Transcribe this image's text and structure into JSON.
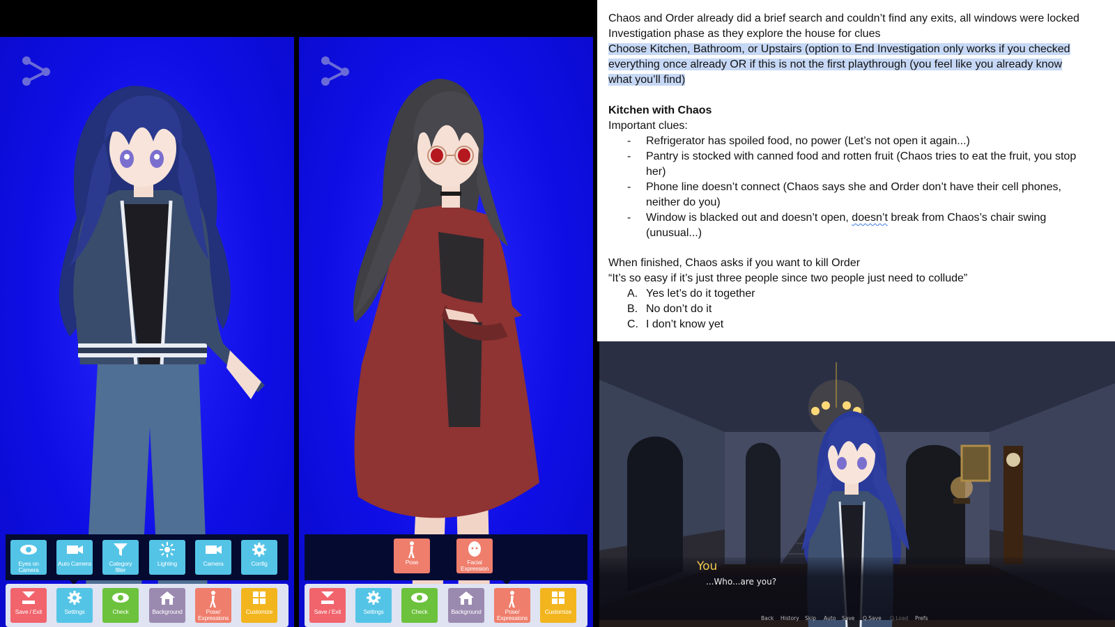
{
  "toolbar_rows": {
    "left_dark": [
      {
        "id": "eyes-on-camera",
        "label": "Eyes on\nCamera",
        "icon": "eye-icon",
        "color": "#54c4e6"
      },
      {
        "id": "auto-camera",
        "label": "Auto Camera",
        "icon": "video-camera-icon",
        "color": "#54c4e6"
      },
      {
        "id": "category-filter",
        "label": "Category\nfilter",
        "icon": "filter-icon",
        "color": "#54c4e6"
      },
      {
        "id": "lighting",
        "label": "Lighting",
        "icon": "light-icon",
        "color": "#54c4e6"
      },
      {
        "id": "camera",
        "label": "Camera",
        "icon": "video-camera-icon",
        "color": "#54c4e6"
      },
      {
        "id": "config",
        "label": "Config",
        "icon": "gear-icon",
        "color": "#54c4e6"
      }
    ],
    "mid_dark": [
      {
        "id": "pose",
        "label": "Pose",
        "icon": "figure-icon",
        "color": "#ef7e6c"
      },
      {
        "id": "facial-expression",
        "label": "Facial\nExpression",
        "icon": "face-icon",
        "color": "#ef7e6c"
      }
    ],
    "bottom": [
      {
        "id": "save-exit",
        "label": "Save / Exit",
        "icon": "save-icon",
        "color": "#f1646c"
      },
      {
        "id": "settings",
        "label": "Settings",
        "icon": "gear-icon",
        "color": "#54c4e6"
      },
      {
        "id": "check",
        "label": "Check",
        "icon": "eye-icon",
        "color": "#6cc23c"
      },
      {
        "id": "background",
        "label": "Background",
        "icon": "home-icon",
        "color": "#9b8ab0"
      },
      {
        "id": "pose-expressions",
        "label": "Pose/\nExpressions",
        "icon": "figure-icon",
        "color": "#ef7e6c"
      },
      {
        "id": "customize",
        "label": "Customize",
        "icon": "grid-icon",
        "color": "#f2b51d"
      }
    ]
  },
  "doc": {
    "line1": "Chaos and Order already did a brief search and couldn’t find any exits, all windows were locked",
    "line2": "Investigation phase as they explore the house for clues",
    "hl1": "Choose Kitchen, Bathroom, or Upstairs (option to End Investigation only works if you checked",
    "hl2": "everything once already OR if this is not the first playthrough (you feel like you already know",
    "hl3": "what you’ll find)",
    "heading": "Kitchen with Chaos",
    "clues_label": "Important clues:",
    "bullet_marker": "-",
    "b1": "Refrigerator has spoiled food, no power (Let’s not open it again...)",
    "b2a": "Pantry is stocked with canned food and rotten fruit (Chaos tries to eat the fruit, you stop",
    "b2b": "her)",
    "b3a": "Phone line doesn’t connect (Chaos says she and Order don’t have their cell phones,",
    "b3b": "neither do you)",
    "b4a_pre": "Window is blacked out and doesn’t open, ",
    "b4a_squiggle": "doesn’t",
    "b4a_post": " break from Chaos’s chair swing",
    "b4b": "(unusual...)",
    "finished": "When finished, Chaos asks if you want to kill Order",
    "quote": "“It’s so easy if it’s just three people since two people just need to collude”",
    "options": [
      {
        "letter": "A.",
        "text": "Yes let’s do it together"
      },
      {
        "letter": "B.",
        "text": "No don’t do it"
      },
      {
        "letter": "C.",
        "text": "I don’t know yet"
      }
    ]
  },
  "game": {
    "speaker": "You",
    "dialog": "...Who...are you?",
    "quick_menu": [
      "Back",
      "History",
      "Skip",
      "Auto",
      "Save",
      "Q.Save",
      "Q.Load",
      "Prefs"
    ],
    "disabled_items": [
      "Q.Load"
    ]
  },
  "colors": {
    "blue_screen": "#0f0fe6",
    "speaker": "#f2c94c",
    "highlight": "#c6d8f5"
  }
}
